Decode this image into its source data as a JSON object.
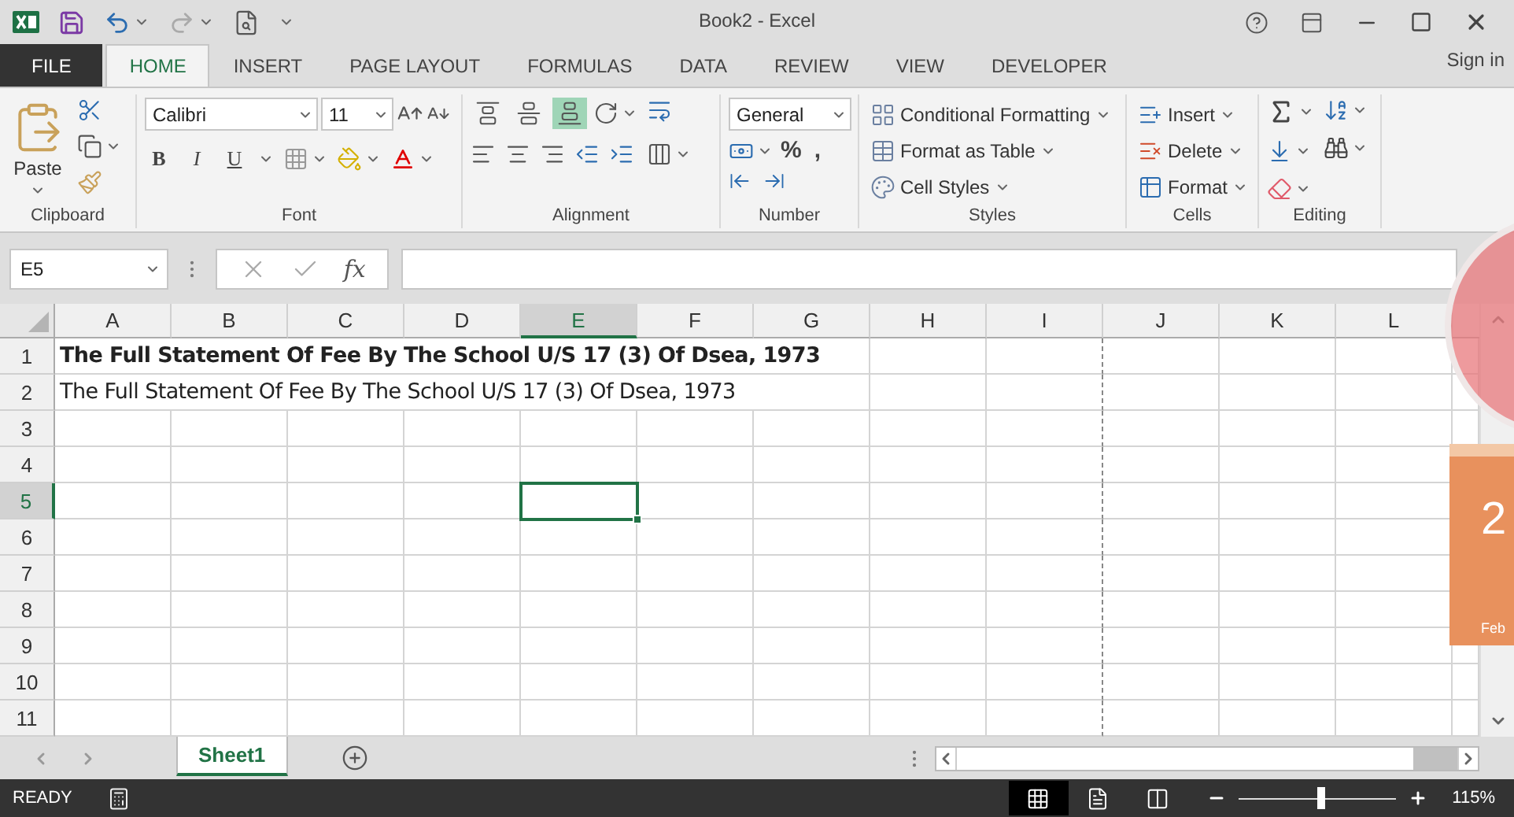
{
  "window": {
    "title": "Book2 - Excel"
  },
  "ribbon_tabs": [
    {
      "label": "FILE",
      "kind": "file",
      "selected": false
    },
    {
      "label": "HOME",
      "kind": "tab",
      "selected": true
    },
    {
      "label": "INSERT",
      "kind": "tab",
      "selected": false
    },
    {
      "label": "PAGE LAYOUT",
      "kind": "tab",
      "selected": false
    },
    {
      "label": "FORMULAS",
      "kind": "tab",
      "selected": false
    },
    {
      "label": "DATA",
      "kind": "tab",
      "selected": false
    },
    {
      "label": "REVIEW",
      "kind": "tab",
      "selected": false
    },
    {
      "label": "VIEW",
      "kind": "tab",
      "selected": false
    },
    {
      "label": "DEVELOPER",
      "kind": "tab",
      "selected": false
    }
  ],
  "account": {
    "label": "Sign in"
  },
  "ribbon": {
    "clipboard": {
      "label": "Clipboard",
      "paste": "Paste"
    },
    "font": {
      "label": "Font",
      "font_name": "Calibri",
      "font_size": "11",
      "style_buttons": [
        "B",
        "I",
        "U"
      ]
    },
    "alignment": {
      "label": "Alignment",
      "vertical": [
        {
          "kind": "top",
          "selected": false
        },
        {
          "kind": "middle",
          "selected": false
        },
        {
          "kind": "bottom",
          "selected": true
        }
      ]
    },
    "number": {
      "label": "Number",
      "format": "General",
      "symbols": [
        "%",
        ","
      ]
    },
    "styles": {
      "label": "Styles",
      "buttons": [
        "Conditional Formatting",
        "Format as Table",
        "Cell Styles"
      ]
    },
    "cells": {
      "label": "Cells",
      "buttons": [
        "Insert",
        "Delete",
        "Format"
      ]
    },
    "editing": {
      "label": "Editing"
    }
  },
  "formula_bar": {
    "name_box": "E5",
    "function_label": "fx"
  },
  "columns": [
    {
      "label": "A",
      "selected": false
    },
    {
      "label": "B",
      "selected": false
    },
    {
      "label": "C",
      "selected": false
    },
    {
      "label": "D",
      "selected": false
    },
    {
      "label": "E",
      "selected": true
    },
    {
      "label": "F",
      "selected": false
    },
    {
      "label": "G",
      "selected": false
    },
    {
      "label": "H",
      "selected": false
    },
    {
      "label": "I",
      "selected": false
    },
    {
      "label": "J",
      "selected": false
    },
    {
      "label": "K",
      "selected": false
    },
    {
      "label": "L",
      "selected": false
    }
  ],
  "rows": [
    {
      "label": "1",
      "selected": false,
      "text": "The Full Statement Of Fee By The School U/S 17 (3) Of Dsea, 1973",
      "bold": true
    },
    {
      "label": "2",
      "selected": false,
      "text": "The Full Statement Of Fee By The School U/S 17 (3) Of Dsea, 1973",
      "bold": false
    },
    {
      "label": "3",
      "selected": false
    },
    {
      "label": "4",
      "selected": false
    },
    {
      "label": "5",
      "selected": true
    },
    {
      "label": "6",
      "selected": false
    },
    {
      "label": "7",
      "selected": false
    },
    {
      "label": "8",
      "selected": false
    },
    {
      "label": "9",
      "selected": false
    },
    {
      "label": "10",
      "selected": false
    },
    {
      "label": "11",
      "selected": false
    }
  ],
  "sheet_tabs": [
    {
      "label": "Sheet1",
      "selected": true
    }
  ],
  "status_bar": {
    "mode": "READY",
    "views": [
      {
        "kind": "normal",
        "selected": true
      },
      {
        "kind": "page_layout",
        "selected": false
      },
      {
        "kind": "page_break",
        "selected": false
      }
    ],
    "zoom": {
      "level": 0.5,
      "reading": "115%"
    }
  },
  "gadgets": {
    "calendar": {
      "day": "2",
      "month": "Feb"
    }
  }
}
